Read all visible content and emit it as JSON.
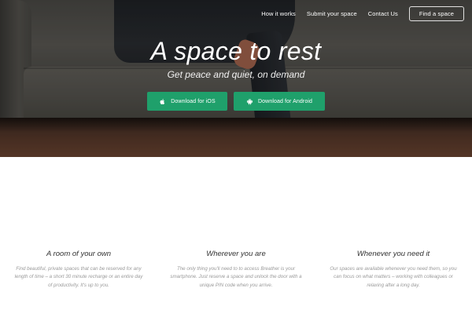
{
  "nav": {
    "how_it_works": "How it works",
    "submit_space": "Submit your space",
    "contact_us": "Contact Us",
    "find_space": "Find a space"
  },
  "hero": {
    "title": "A space to rest",
    "subtitle": "Get peace and quiet, on demand",
    "download_ios": "Download for iOS",
    "download_android": "Download for Android",
    "icons": {
      "ios": "apple-icon",
      "android": "android-icon"
    }
  },
  "colors": {
    "accent_green": "#1fa06b"
  },
  "features": [
    {
      "title": "A room of your own",
      "text": "Find beautiful, private spaces that can be reserved for any length of time – a short 30 minute recharge or an entire day of productivity. It's up to you."
    },
    {
      "title": "Wherever you are",
      "text": "The only thing you'll need to to access Breather is your smartphone. Just reserve a space and unlock the door with a unique PIN code when you arrive."
    },
    {
      "title": "Whenever you need it",
      "text": "Our spaces are available whenever you need them, so you can focus on what matters – working with colleagues or relaxing after a long day."
    }
  ]
}
